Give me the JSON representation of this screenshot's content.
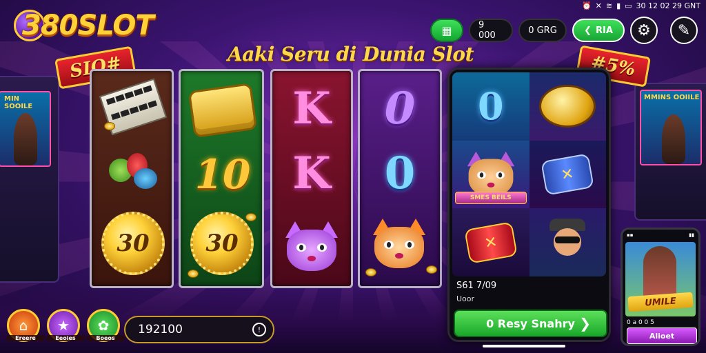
{
  "brand": {
    "logo": "380SLOT"
  },
  "status_bar": {
    "time": "30 12 02 29 GNT",
    "icons": [
      "alarm-icon",
      "mute-icon",
      "wifi-icon",
      "signal-icon",
      "battery-icon"
    ]
  },
  "top_bar": {
    "coins": "9 000",
    "gems": "0 GRG",
    "action_label": "RIA"
  },
  "headline": "Aaki Seru di Dunia Slot",
  "ribbons": {
    "left": "SIO#",
    "right": "#5%"
  },
  "reels": [
    {
      "symbols": [
        "ticket",
        "fruit",
        "30"
      ]
    },
    {
      "symbols": [
        "gold-block",
        "10",
        "30"
      ]
    },
    {
      "symbols": [
        "K",
        "K",
        "cat-purple"
      ]
    },
    {
      "symbols": [
        "0",
        "0",
        "cat-orange"
      ]
    }
  ],
  "phone": {
    "cat_banner": "SMES BEILS",
    "info_line1": "S61 7/09",
    "info_line2": "Uoor",
    "play_button": "0 Resy Snahry"
  },
  "mini_phone": {
    "title": "UMILE",
    "info": "0 a 0 0 5",
    "button": "Alioet"
  },
  "cabinets": {
    "left_title": "MIN SOOILE",
    "right_title": "MMINS OOIILE"
  },
  "bottom": {
    "icons": [
      {
        "icon": "home-icon",
        "label": "Ereere",
        "color": "orange"
      },
      {
        "icon": "star-icon",
        "label": "Eeoies",
        "color": "purple"
      },
      {
        "icon": "gift-icon",
        "label": "Boeos",
        "color": "green"
      }
    ],
    "balance": "192100"
  },
  "colors": {
    "accent": "#ffd23a",
    "green": "#1aa82a",
    "purple": "#5a16a8"
  }
}
